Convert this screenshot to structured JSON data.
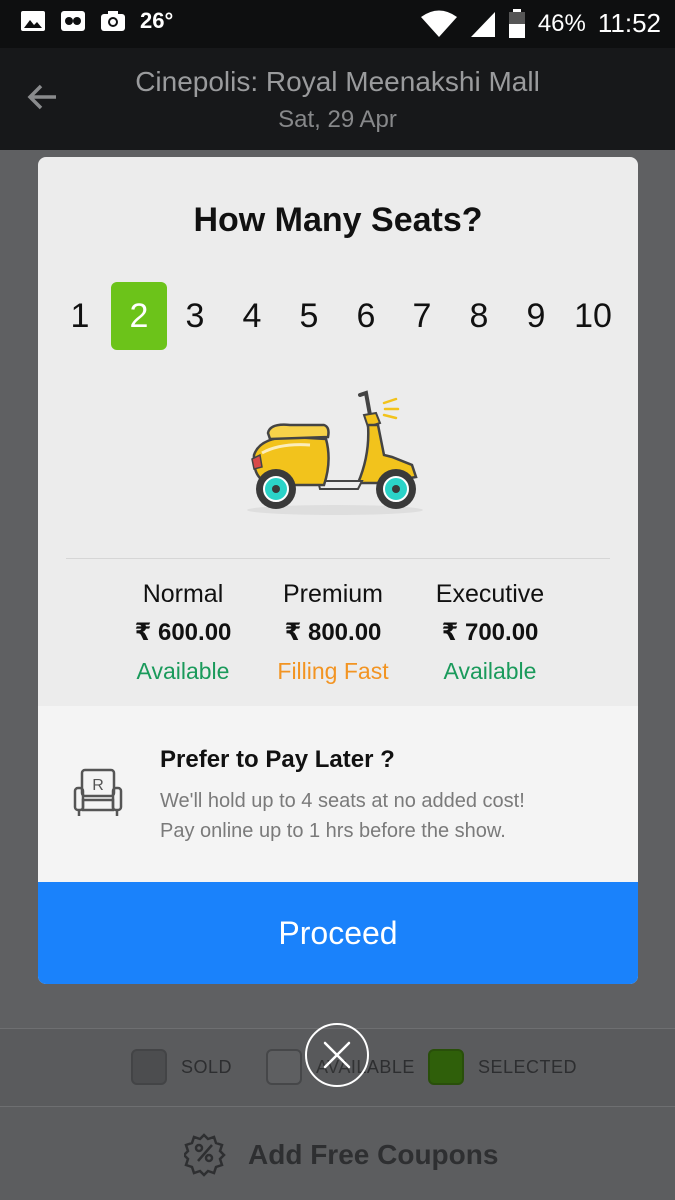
{
  "status_bar": {
    "temperature": "26°",
    "battery": "46%",
    "time": "11:52",
    "icons": [
      "gallery-icon",
      "messenger-icon",
      "camera-icon",
      "wifi-icon",
      "signal-icon",
      "battery-icon"
    ]
  },
  "header": {
    "title": "Cinepolis: Royal Meenakshi Mall",
    "subtitle": "Sat, 29 Apr",
    "back_icon": "arrow-left-icon"
  },
  "modal": {
    "title": "How Many Seats?",
    "seat_options": [
      "1",
      "2",
      "3",
      "4",
      "5",
      "6",
      "7",
      "8",
      "9",
      "10"
    ],
    "selected_seat": "2",
    "illustration": "scooter-icon",
    "categories": [
      {
        "name": "Normal",
        "price": "₹ 600.00",
        "status": "Available",
        "status_color": "#1a9a5b"
      },
      {
        "name": "Premium",
        "price": "₹ 800.00",
        "status": "Filling Fast",
        "status_color": "#f29422"
      },
      {
        "name": "Executive",
        "price": "₹ 700.00",
        "status": "Available",
        "status_color": "#1a9a5b"
      }
    ],
    "pay_later": {
      "title": "Prefer to Pay Later ?",
      "line1": "We'll hold up to 4 seats at no added cost!",
      "line2": "Pay online up to 1 hrs before the show.",
      "icon": "reserved-seat-icon"
    },
    "proceed_label": "Proceed"
  },
  "legend": {
    "sold": "SOLD",
    "available": "AVAILABLE",
    "selected": "SELECTED"
  },
  "coupon": {
    "label": "Add Free Coupons",
    "icon": "coupon-icon"
  },
  "colors": {
    "accent_green": "#6cc31a",
    "proceed_blue": "#1a82fb",
    "available_green": "#1a9a5b",
    "filling_orange": "#f29422"
  }
}
